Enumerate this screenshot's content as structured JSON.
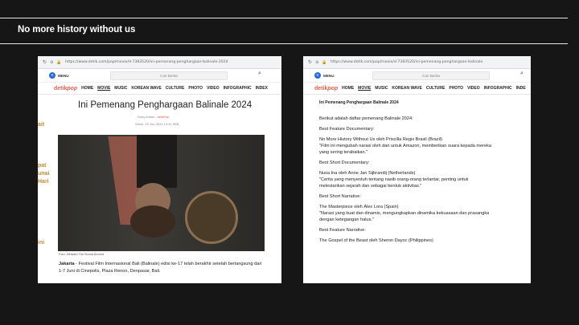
{
  "slide": {
    "title": "No more history without us"
  },
  "left_screenshot": {
    "url": "https://www.detik.com/pop/movie/d-7383520/ini-pemenang-penghargaan-balinale-2024",
    "search_placeholder": "Cari Berita",
    "menu_label": "MENU",
    "logo_main": "detik",
    "logo_sub": "pop",
    "nav_items": [
      "HOME",
      "MOVIE",
      "MUSIC",
      "KOREAN WAVE",
      "CULTURE",
      "PHOTO",
      "VIDEO",
      "INFOGRAPHIC",
      "INDEX"
    ],
    "side_banner": [
      "ait",
      "pat",
      "unai",
      "Hari",
      "ini"
    ],
    "article_title": "Ini Pemenang Penghargaan Balinale 2024",
    "byline_author": "Dicky Ardian",
    "byline_sep": " - ",
    "byline_site": "detikPop",
    "dateline": "Senin, 10 Jun 2024 13:31 WIB",
    "photo_caption": "Foto: Dthwani The Sound Around",
    "lead_place": "Jakarta",
    "lead_text": " - Festival Film Internasional Bali (Balinale) edisi ke-17 telah berakhir setelah berlangsung dari 1-7 Juni di Cinepolis, Plaza Renon, Denpasar, Bali."
  },
  "right_screenshot": {
    "url": "https://www.detik.com/pop/movie/d-7383520/ini-pemenang-penghargaan-balinale",
    "search_placeholder": "Cari Berita",
    "menu_label": "MENU",
    "logo_main": "detik",
    "logo_sub": "pop",
    "nav_items": [
      "HOME",
      "MOVIE",
      "MUSIC",
      "KOREAN WAVE",
      "CULTURE",
      "PHOTO",
      "VIDEO",
      "INFOGRAPHIC",
      "INDE"
    ],
    "article_title": "Ini Pemenang Penghargaan Balinale 2024",
    "list_lines": [
      "Berikut adalah daftar pemenang Balinale 2024:",
      "",
      "Best Feature Documentary:",
      "",
      "No More History Without Us oleh Priscilla Regis Brasil (Brazil)",
      "\"Film ini mengubah narasi oleh dan untuk Amazon, memberikan suara kepada mereka",
      "yang sering terabaikan.\"",
      "",
      "Best Short Documentary:",
      "",
      "Nusa Ina oleh Anne Jan Sijbrandij (Netherlands)",
      "\"Cerita yang menyentuh tentang nasib orang-orang terlantar, penting untuk",
      "melestarikan sejarah dan sebagai bentuk aktivitas.\"",
      "",
      "Best Short Narrative:",
      "",
      "The Masterpiece oleh Àlex Lora (Spain)",
      "\"Narasi yang kuat dan dinamis, mengungkapkan dinamika kekuasaan dan prasangka",
      "dengan ketegangan halus.\"",
      "",
      "Best Feature Narrative:",
      "",
      "The Gospel of the Beast oleh Sheron Dayoc (Philippines)"
    ]
  }
}
